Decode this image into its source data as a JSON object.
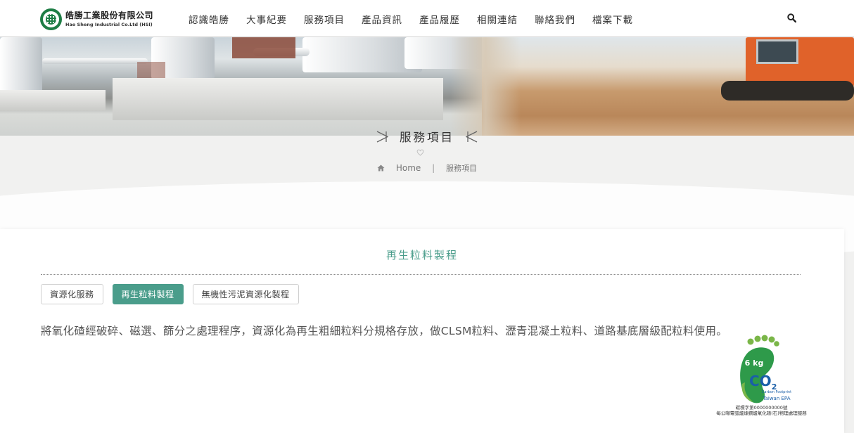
{
  "header": {
    "logo_cn": "皓勝工業股份有限公司",
    "logo_en": "Hao Sheng Industrial Co.Ltd (HSI)",
    "nav": [
      "認識皓勝",
      "大事紀要",
      "服務項目",
      "產品資訊",
      "產品履歷",
      "相關連結",
      "聯絡我們",
      "檔案下載"
    ]
  },
  "page_title": "服務項目",
  "breadcrumb": {
    "home": "Home",
    "separator": "|",
    "current": "服務項目"
  },
  "content": {
    "section_title": "再生粒料製程",
    "tabs": [
      {
        "label": "資源化服務",
        "active": false
      },
      {
        "label": "再生粒料製程",
        "active": true
      },
      {
        "label": "無機性污泥資源化製程",
        "active": false
      }
    ],
    "description": "將氧化碴經破碎、磁選、篩分之處理程序，資源化為再生粗細粒料分規格存放，做CLSM粒料、瀝青混凝土粒料、道路基底層級配粒料使用。"
  },
  "carbon_badge": {
    "amount": "6 kg",
    "co2": "CO",
    "co2_sub": "2",
    "sub_label": "Carbon Footprint",
    "agency": "Taiwan EPA",
    "cert_line1": "碳標字第0000000000號",
    "cert_line2": "每公噸電弧爐煉鋼爐氧化碴(石)物理處理服務"
  },
  "colors": {
    "accent": "#4a9d8b",
    "logo_green": "#1e7d45",
    "badge_green": "#7ab648",
    "badge_blue": "#1a5fa8"
  }
}
